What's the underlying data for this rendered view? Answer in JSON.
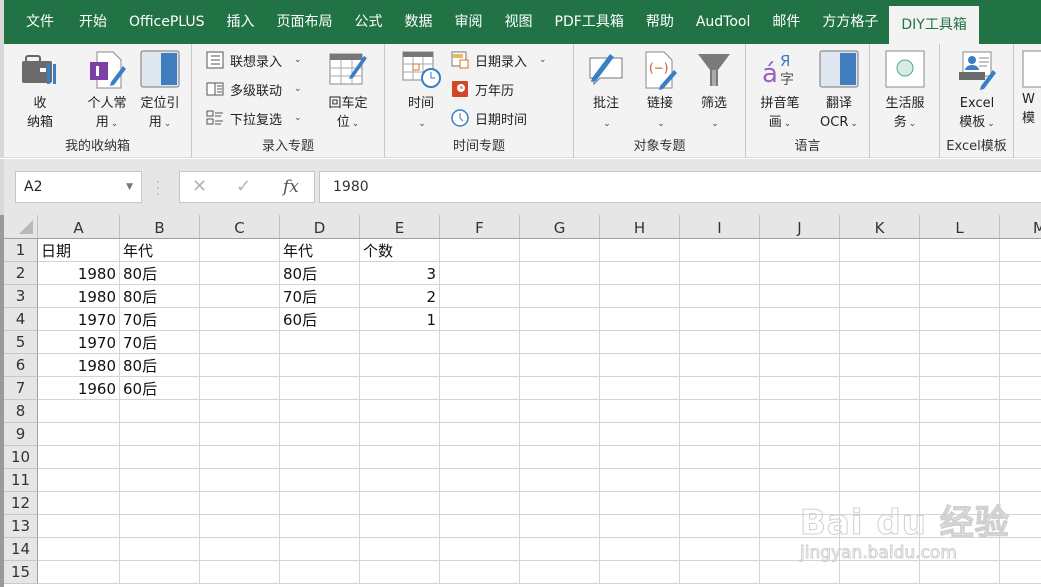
{
  "tabs": [
    {
      "label": "文件",
      "active": false
    },
    {
      "label": "开始",
      "active": false
    },
    {
      "label": "OfficePLUS",
      "active": false
    },
    {
      "label": "插入",
      "active": false
    },
    {
      "label": "页面布局",
      "active": false
    },
    {
      "label": "公式",
      "active": false
    },
    {
      "label": "数据",
      "active": false
    },
    {
      "label": "审阅",
      "active": false
    },
    {
      "label": "视图",
      "active": false
    },
    {
      "label": "PDF工具箱",
      "active": false
    },
    {
      "label": "帮助",
      "active": false
    },
    {
      "label": "AudTool",
      "active": false
    },
    {
      "label": "邮件",
      "active": false
    },
    {
      "label": "方方格子",
      "active": false
    },
    {
      "label": "DIY工具箱",
      "active": true
    }
  ],
  "ribbon": {
    "groups": {
      "storage": {
        "label": "我的收纳箱",
        "buttons": [
          {
            "line1": "收",
            "line2": "纳箱",
            "icon": "toolbox-icon"
          },
          {
            "line1": "个人常",
            "line2": "用",
            "icon": "onenote-doc-icon",
            "dropdown": true
          },
          {
            "line1": "定位引",
            "line2": "用",
            "icon": "split-panel-icon",
            "dropdown": true
          }
        ]
      },
      "entry": {
        "label": "录入专题",
        "small": [
          {
            "label": "联想录入",
            "icon": "list-icon"
          },
          {
            "label": "多级联动",
            "icon": "cascade-icon"
          },
          {
            "label": "下拉复选",
            "icon": "checklist-icon"
          }
        ],
        "big": {
          "line1": "回车定",
          "line2": "位",
          "icon": "table-edit-icon"
        }
      },
      "time": {
        "label": "时间专题",
        "big": {
          "line1": "时间",
          "line2": "",
          "icon": "calendar-clock-icon"
        },
        "small": [
          {
            "label": "日期录入",
            "icon": "date-entry-icon",
            "dropdown": true
          },
          {
            "label": "万年历",
            "icon": "perpetual-calendar-icon"
          },
          {
            "label": "日期时间",
            "icon": "clock-icon"
          }
        ]
      },
      "objects": {
        "label": "对象专题",
        "buttons": [
          {
            "line1": "批注",
            "icon": "comment-icon"
          },
          {
            "line1": "链接",
            "icon": "link-doc-icon"
          },
          {
            "line1": "筛选",
            "icon": "filter-icon"
          }
        ]
      },
      "language": {
        "label": "语言",
        "buttons": [
          {
            "line1": "拼音笔",
            "line2": "画",
            "icon": "pinyin-icon"
          },
          {
            "line1": "翻译",
            "line2": "OCR",
            "icon": "split-panel-icon"
          }
        ]
      },
      "life": {
        "label": "",
        "buttons": [
          {
            "line1": "生活服",
            "line2": "务",
            "icon": "circle-icon"
          }
        ]
      },
      "excel_tpl": {
        "label": "Excel模板",
        "buttons": [
          {
            "line1": "Excel",
            "line2": "模板",
            "icon": "template-card-icon"
          }
        ]
      },
      "word_tpl": {
        "buttons": [
          {
            "line1": "W",
            "line2": "模"
          }
        ]
      }
    }
  },
  "formula_bar": {
    "name_box": "A2",
    "cancel": "✕",
    "enter": "✓",
    "fx": "fx",
    "value": "1980"
  },
  "sheet": {
    "columns": [
      "A",
      "B",
      "C",
      "D",
      "E",
      "F",
      "G",
      "H",
      "I",
      "J",
      "K",
      "L",
      "M"
    ],
    "rows": [
      "1",
      "2",
      "3",
      "4",
      "5",
      "6",
      "7",
      "8",
      "9",
      "10",
      "11",
      "12",
      "13",
      "14",
      "15"
    ],
    "cells": {
      "A1": "日期",
      "B1": "年代",
      "D1": "年代",
      "E1": "个数",
      "A2": "1980",
      "B2": "80后",
      "D2": "80后",
      "E2": "3",
      "A3": "1980",
      "B3": "80后",
      "D3": "70后",
      "E3": "2",
      "A4": "1970",
      "B4": "70后",
      "D4": "60后",
      "E4": "1",
      "A5": "1970",
      "B5": "70后",
      "A6": "1980",
      "B6": "80后",
      "A7": "1960",
      "B7": "60后"
    },
    "numeric_cells": [
      "A2",
      "A3",
      "A4",
      "A5",
      "A6",
      "A7",
      "E2",
      "E3",
      "E4"
    ]
  },
  "watermark": {
    "brand": "Bai du 经验",
    "url": "jingyan.baidu.com"
  }
}
